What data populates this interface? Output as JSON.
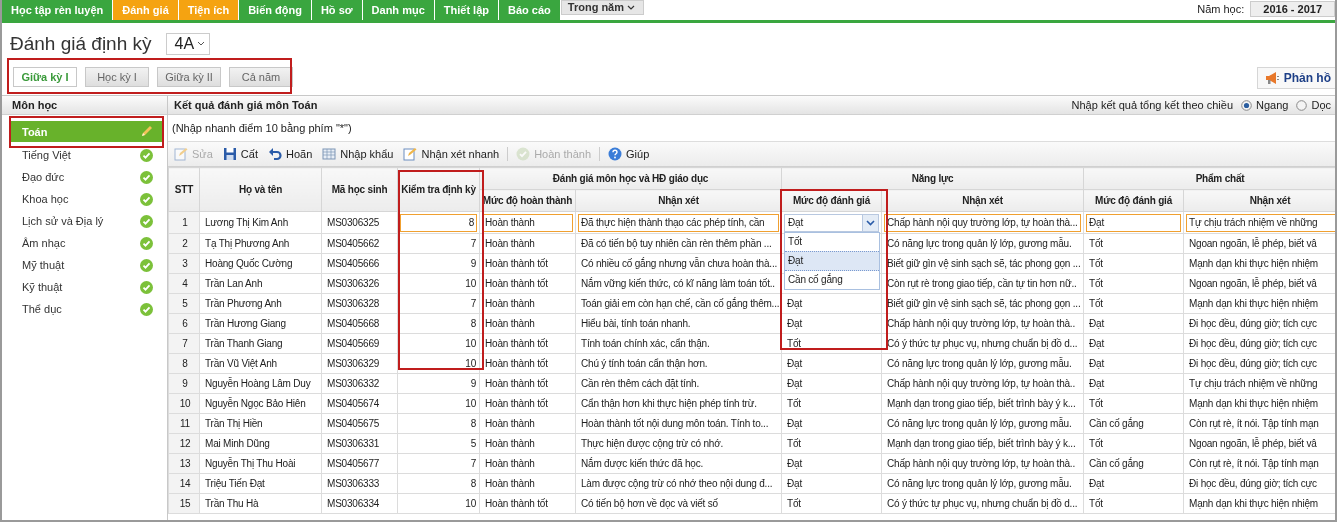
{
  "top_menu": [
    {
      "label": "Học tập rèn luyện",
      "selected": false
    },
    {
      "label": "Đánh giá",
      "selected": true
    },
    {
      "label": "Tiện ích",
      "selected": true
    },
    {
      "label": "Biến động",
      "selected": false
    },
    {
      "label": "Hồ sơ",
      "selected": false
    },
    {
      "label": "Danh mục",
      "selected": false
    },
    {
      "label": "Thiết lập",
      "selected": false
    },
    {
      "label": "Báo cáo",
      "selected": false
    }
  ],
  "period_dropdown": "Trong năm",
  "school_year": {
    "label": "Năm học:",
    "value": "2016 - 2017"
  },
  "page_title": "Đánh giá định kỳ",
  "class_select": "4A",
  "terms": [
    {
      "label": "Giữa kỳ I",
      "selected": true
    },
    {
      "label": "Học kỳ I",
      "selected": false
    },
    {
      "label": "Giữa kỳ II",
      "selected": false
    },
    {
      "label": "Cả năm",
      "selected": false
    }
  ],
  "feedback_button": "Phản hồ",
  "subjects": {
    "header": "Môn học",
    "items": [
      {
        "label": "Toán",
        "selected": true
      },
      {
        "label": "Tiếng Việt",
        "selected": false
      },
      {
        "label": "Đạo đức",
        "selected": false
      },
      {
        "label": "Khoa học",
        "selected": false
      },
      {
        "label": "Lịch sử và Địa lý",
        "selected": false
      },
      {
        "label": "Âm nhạc",
        "selected": false
      },
      {
        "label": "Mỹ thuật",
        "selected": false
      },
      {
        "label": "Kỹ thuật",
        "selected": false
      },
      {
        "label": "Thể dục",
        "selected": false
      }
    ]
  },
  "results": {
    "title": "Kết quả đánh giá môn Toán",
    "orientation_label": "Nhập kết quả tổng kết theo chiều",
    "orientation_options": [
      {
        "label": "Ngang",
        "selected": true
      },
      {
        "label": "Dọc",
        "selected": false
      }
    ],
    "hint": "(Nhập nhanh điểm 10 bằng phím \"*\")",
    "toolbar": [
      {
        "kind": "edit",
        "label": "Sửa",
        "disabled": true
      },
      {
        "kind": "save",
        "label": "Cất",
        "disabled": false
      },
      {
        "kind": "undo",
        "label": "Hoãn",
        "disabled": false
      },
      {
        "kind": "import",
        "label": "Nhập khẩu",
        "disabled": false
      },
      {
        "kind": "comment",
        "label": "Nhận xét nhanh",
        "disabled": false
      },
      {
        "kind": "separator"
      },
      {
        "kind": "complete",
        "label": "Hoàn thành",
        "disabled": true
      },
      {
        "kind": "separator"
      },
      {
        "kind": "help",
        "label": "Giúp",
        "disabled": false
      }
    ],
    "table": {
      "columns": [
        "STT",
        "Họ và tên",
        "Mã học sinh",
        "Kiểm tra định kỳ"
      ],
      "groups": [
        {
          "label": "Đánh giá môn học và HĐ giáo dục",
          "columns": [
            "Mức độ hoàn thành",
            "Nhận xét"
          ]
        },
        {
          "label": "Năng lực",
          "columns": [
            "Mức độ đánh giá",
            "Nhận xét"
          ]
        },
        {
          "label": "Phẩm chất",
          "columns": [
            "Mức độ đánh giá",
            "Nhận xét"
          ]
        }
      ],
      "dropdown": {
        "options": [
          {
            "label": "Tốt",
            "selected": false
          },
          {
            "label": "Đạt",
            "selected": true
          },
          {
            "label": "Cần cố gắng",
            "selected": false
          }
        ]
      },
      "rows": [
        {
          "editing": true,
          "stt": "1",
          "name": "Lương Thị Kim Anh",
          "id": "MS0306325",
          "score": "8",
          "completion": "Hoàn thành",
          "subject_comment": "Đã thực hiện thành thạo các phép tính, cần",
          "competence_level": "Đạt",
          "competence_comment": "Chấp hành nội quy trường lớp, tự hoàn thà...",
          "quality_level": "Đạt",
          "quality_comment": "Tự chịu trách nhiệm về những"
        },
        {
          "editing": false,
          "stt": "2",
          "name": "Tạ Thị Phương Anh",
          "id": "MS0405662",
          "score": "7",
          "completion": "Hoàn thành",
          "subject_comment": "Đã có tiến bộ tuy nhiên cần rèn thêm phần ...",
          "competence_comment": "Có năng lực trong quản lý lớp, gương mẫu.",
          "quality_level": "Tốt",
          "quality_comment": "Ngoan ngoãn, lễ phép, biết vâ"
        },
        {
          "editing": false,
          "stt": "3",
          "name": "Hoàng Quốc Cường",
          "id": "MS0405666",
          "score": "9",
          "completion": "Hoàn thành tốt",
          "subject_comment": "Có nhiều cố gắng nhưng vẫn chưa hoàn thà...",
          "competence_comment": "Biết giữ gìn vệ sinh sạch sẽ, tác phong gọn ...",
          "quality_level": "Tốt",
          "quality_comment": "Mạnh dạn khi thực hiện nhiệm"
        },
        {
          "editing": false,
          "stt": "4",
          "name": "Trần Lan Anh",
          "id": "MS0306326",
          "score": "10",
          "completion": "Hoàn thành tốt",
          "subject_comment": "Nắm vững kiến thức, có kĩ năng làm toán tốt..",
          "competence_comment": "Còn rụt rè trong giao tiếp, cần tự tin hơn nữ..",
          "quality_level": "Tốt",
          "quality_comment": "Ngoan ngoãn, lễ phép, biết vâ"
        },
        {
          "editing": false,
          "stt": "5",
          "name": "Trần Phương Anh",
          "id": "MS0306328",
          "score": "7",
          "completion": "Hoàn thành",
          "subject_comment": "Toán giải em còn hạn chế, cần cố gắng thêm...",
          "competence_level": "Đạt",
          "competence_comment": "Biết giữ gìn vệ sinh sạch sẽ, tác phong gọn ...",
          "quality_level": "Tốt",
          "quality_comment": "Mạnh dạn khi thực hiện nhiệm"
        },
        {
          "editing": false,
          "stt": "6",
          "name": "Trần Hương Giang",
          "id": "MS0405668",
          "score": "8",
          "completion": "Hoàn thành",
          "subject_comment": "Hiểu bài, tính toán nhanh.",
          "competence_level": "Đạt",
          "competence_comment": "Chấp hành nội quy trường lớp, tự hoàn thà..",
          "quality_level": "Đạt",
          "quality_comment": "Đi học đều, đúng giờ; tích cực"
        },
        {
          "editing": false,
          "stt": "7",
          "name": "Trần Thanh Giang",
          "id": "MS0405669",
          "score": "10",
          "completion": "Hoàn thành tốt",
          "subject_comment": "Tính toán chính xác, cẩn thận.",
          "competence_level": "Tốt",
          "competence_comment": "Có ý thức tự phục vụ, nhưng chuẩn bị đồ d...",
          "quality_level": "Đạt",
          "quality_comment": "Đi học đều, đúng giờ; tích cực"
        },
        {
          "editing": false,
          "stt": "8",
          "name": "Trần Vũ Việt Anh",
          "id": "MS0306329",
          "score": "10",
          "completion": "Hoàn thành tốt",
          "subject_comment": "Chú ý tính toán cẩn thận hơn.",
          "competence_level": "Đạt",
          "competence_comment": "Có năng lực trong quản lý lớp, gương mẫu.",
          "quality_level": "Đạt",
          "quality_comment": "Đi học đều, đúng giờ; tích cực"
        },
        {
          "editing": false,
          "stt": "9",
          "name": "Nguyễn Hoàng Lâm Duy",
          "id": "MS0306332",
          "score": "9",
          "completion": "Hoàn thành tốt",
          "subject_comment": "Cần rèn thêm cách đặt tính.",
          "competence_level": "Đạt",
          "competence_comment": "Chấp hành nội quy trường lớp, tự hoàn thà..",
          "quality_level": "Đạt",
          "quality_comment": "Tự chịu trách nhiệm về những"
        },
        {
          "editing": false,
          "stt": "10",
          "name": "Nguyễn Ngọc Bảo Hiên",
          "id": "MS0405674",
          "score": "10",
          "completion": "Hoàn thành tốt",
          "subject_comment": "Cẩn thận hơn khi thực hiện phép tính trừ.",
          "competence_level": "Tốt",
          "competence_comment": "Mạnh dạn trong giao tiếp, biết trình bày ý k...",
          "quality_level": "Tốt",
          "quality_comment": "Mạnh dạn khi thực hiện nhiệm"
        },
        {
          "editing": false,
          "stt": "11",
          "name": "Trần Thị Hiền",
          "id": "MS0405675",
          "score": "8",
          "completion": "Hoàn thành",
          "subject_comment": "Hoàn thành tốt nội dung môn toán. Tính to...",
          "competence_level": "Đạt",
          "competence_comment": "Có năng lực trong quản lý lớp, gương mẫu.",
          "quality_level": "Cần cố gắng",
          "quality_comment": "Còn rụt rè, ít nói. Tập tính mạn"
        },
        {
          "editing": false,
          "stt": "12",
          "name": "Mai Minh Dũng",
          "id": "MS0306331",
          "score": "5",
          "completion": "Hoàn thành",
          "subject_comment": "Thực hiện được cộng trừ có nhớ.",
          "competence_level": "Tốt",
          "competence_comment": "Mạnh dạn trong giao tiếp, biết trình bày ý k...",
          "quality_level": "Tốt",
          "quality_comment": "Ngoan ngoãn, lễ phép, biết vâ"
        },
        {
          "editing": false,
          "stt": "13",
          "name": "Nguyễn Thị Thu Hoài",
          "id": "MS0405677",
          "score": "7",
          "completion": "Hoàn thành",
          "subject_comment": "Nắm được kiến thức đã học.",
          "competence_level": "Đạt",
          "competence_comment": "Chấp hành nội quy trường lớp, tự hoàn thà..",
          "quality_level": "Cần cố gắng",
          "quality_comment": "Còn rụt rè, ít nói. Tập tính mạn"
        },
        {
          "editing": false,
          "stt": "14",
          "name": "Triệu Tiến Đạt",
          "id": "MS0306333",
          "score": "8",
          "completion": "Hoàn thành",
          "subject_comment": "Làm được cộng trừ có nhớ theo nội dung đ...",
          "competence_level": "Đạt",
          "competence_comment": "Có năng lực trong quản lý lớp, gương mẫu.",
          "quality_level": "Đạt",
          "quality_comment": "Đi học đều, đúng giờ; tích cực"
        },
        {
          "editing": false,
          "stt": "15",
          "name": "Trần Thu Hà",
          "id": "MS0306334",
          "score": "10",
          "completion": "Hoàn thành tốt",
          "subject_comment": "Có tiến bộ hơn về đọc và viết số",
          "competence_level": "Tốt",
          "competence_comment": "Có ý thức tự phục vụ, nhưng chuẩn bị đồ d...",
          "quality_level": "Tốt",
          "quality_comment": "Mạnh dạn khi thực hiện nhiệm"
        }
      ]
    }
  }
}
